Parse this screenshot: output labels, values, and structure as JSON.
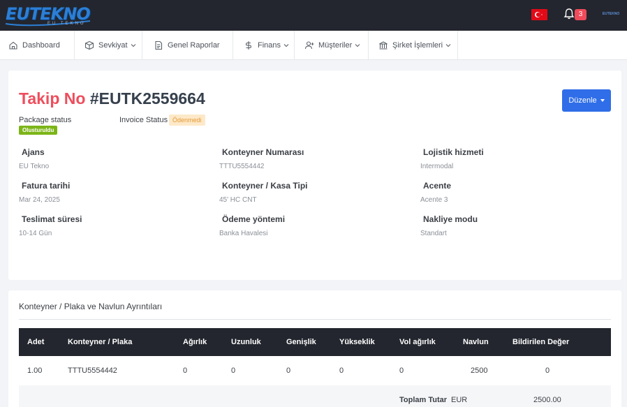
{
  "brand": {
    "logo_text": "EUTEKNO",
    "logo_sub": "EU TEKNO"
  },
  "topbar": {
    "notification_count": "3",
    "user_text": "EUTEKNO",
    "flag_color": "#e30a17"
  },
  "nav": {
    "items": [
      {
        "label": "Dashboard",
        "icon": "home-icon"
      },
      {
        "label": "Sevkiyat",
        "icon": "box-icon"
      },
      {
        "label": "Genel Raporlar",
        "icon": "document-icon"
      },
      {
        "label": "Finans",
        "icon": "dollar-icon"
      },
      {
        "label": "Müşteriler",
        "icon": "user-plus-icon"
      },
      {
        "label": "Şirket İşlemleri",
        "icon": "bank-icon"
      }
    ]
  },
  "header": {
    "title_label": "Takip No",
    "tracking_no": "#EUTK2559664",
    "edit_button": "Düzenle",
    "package_status_label": "Package status",
    "package_status_value": "Olusturuldu",
    "invoice_status_label": "Invoice Status",
    "invoice_status_value": "Ödenmedi"
  },
  "details": [
    {
      "key": "Ajans",
      "value": "EU Tekno"
    },
    {
      "key": "Konteyner Numarası",
      "value": "TTTU5554442"
    },
    {
      "key": "Lojistik hizmeti",
      "value": "Intermodal"
    },
    {
      "key": "Fatura tarihi",
      "value": "Mar 24, 2025"
    },
    {
      "key": "Konteyner / Kasa Tipi",
      "value": "45' HC CNT"
    },
    {
      "key": "Acente",
      "value": "Acente 3"
    },
    {
      "key": "Teslimat süresi",
      "value": "10-14 Gün"
    },
    {
      "key": "Ödeme yöntemi",
      "value": "Banka Havalesi"
    },
    {
      "key": "Nakliye modu",
      "value": "Standart"
    }
  ],
  "freight": {
    "section_title": "Konteyner / Plaka ve Navlun Ayrıntıları",
    "columns": [
      "Adet",
      "Konteyner / Plaka",
      "Ağırlık",
      "Uzunluk",
      "Genişlik",
      "Yükseklik",
      "Vol ağırlık",
      "Navlun",
      "Bildirilen Değer"
    ],
    "rows": [
      [
        "1.00",
        "TTTU5554442",
        "0",
        "0",
        "0",
        "0",
        "0",
        "2500",
        "0"
      ]
    ],
    "total_label": "Toplam Tutar",
    "total_currency": "EUR",
    "total_value": "2500.00"
  },
  "colors": {
    "accent": "#2f6ee8",
    "title_red": "#ee4e5d",
    "dark": "#23262e",
    "status_green": "#7cb518"
  }
}
